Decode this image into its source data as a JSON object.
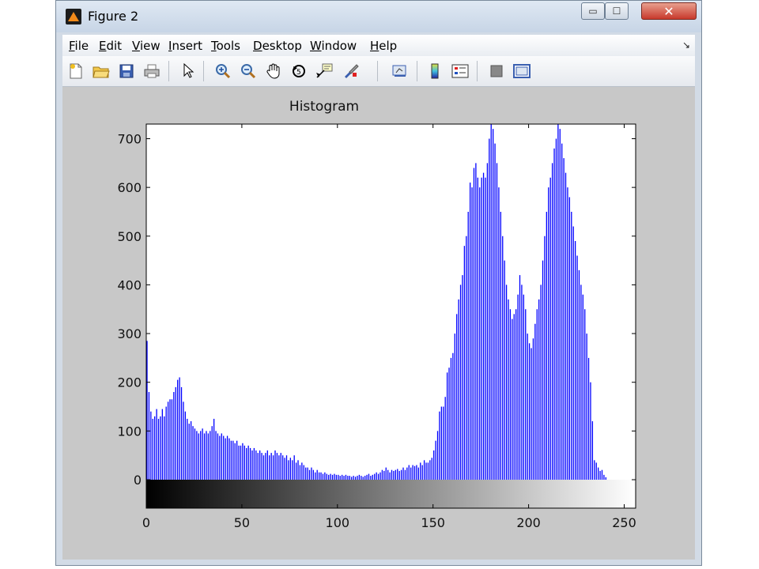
{
  "window": {
    "title": "Figure 2",
    "controls": {
      "minimize": "▭",
      "maximize": "☐",
      "close": "✕"
    }
  },
  "menu": {
    "items": [
      {
        "label": "File",
        "mnemonic": "F"
      },
      {
        "label": "Edit",
        "mnemonic": "E"
      },
      {
        "label": "View",
        "mnemonic": "V"
      },
      {
        "label": "Insert",
        "mnemonic": "I"
      },
      {
        "label": "Tools",
        "mnemonic": "T"
      },
      {
        "label": "Desktop",
        "mnemonic": "D"
      },
      {
        "label": "Window",
        "mnemonic": "W"
      },
      {
        "label": "Help",
        "mnemonic": "H"
      }
    ],
    "dock_icon": "↘"
  },
  "toolbar": {
    "tools": [
      "new-figure-icon",
      "open-file-icon",
      "save-icon",
      "print-icon",
      "select-arrow-icon",
      "zoom-in-icon",
      "zoom-out-icon",
      "pan-hand-icon",
      "rotate-3d-icon",
      "data-cursor-icon",
      "brush-icon",
      "link-plot-icon",
      "colorbar-icon",
      "legend-icon",
      "hide-plot-tools-icon",
      "show-plot-tools-icon"
    ]
  },
  "chart_data": {
    "type": "bar",
    "title": "Histogram",
    "xlabel": "",
    "ylabel": "",
    "xlim": [
      0,
      256
    ],
    "ylim": [
      0,
      730
    ],
    "x_ticks": [
      0,
      50,
      100,
      150,
      200,
      250
    ],
    "y_ticks": [
      0,
      100,
      200,
      300,
      400,
      500,
      600,
      700
    ],
    "bar_color": "#0000ff",
    "colorbar": "grayscale 0-255 below x-axis",
    "x_start": 0,
    "values": [
      285,
      180,
      140,
      125,
      130,
      145,
      125,
      130,
      145,
      130,
      150,
      160,
      165,
      165,
      180,
      190,
      205,
      210,
      190,
      160,
      140,
      125,
      115,
      120,
      110,
      105,
      100,
      95,
      100,
      105,
      95,
      100,
      95,
      100,
      110,
      125,
      100,
      95,
      90,
      95,
      90,
      85,
      90,
      85,
      80,
      80,
      75,
      80,
      70,
      70,
      75,
      70,
      65,
      70,
      65,
      60,
      65,
      60,
      55,
      60,
      55,
      50,
      55,
      60,
      50,
      55,
      50,
      60,
      55,
      50,
      55,
      50,
      45,
      50,
      40,
      45,
      40,
      50,
      35,
      40,
      30,
      35,
      30,
      25,
      25,
      20,
      25,
      20,
      15,
      20,
      15,
      15,
      12,
      15,
      12,
      10,
      12,
      10,
      12,
      10,
      10,
      8,
      10,
      8,
      10,
      8,
      8,
      6,
      8,
      6,
      8,
      10,
      8,
      6,
      8,
      10,
      12,
      8,
      10,
      12,
      15,
      12,
      15,
      20,
      18,
      25,
      20,
      15,
      20,
      18,
      20,
      22,
      18,
      20,
      25,
      20,
      25,
      30,
      25,
      30,
      28,
      30,
      25,
      35,
      30,
      40,
      35,
      35,
      40,
      45,
      60,
      80,
      100,
      140,
      150,
      150,
      170,
      220,
      230,
      250,
      260,
      300,
      340,
      370,
      400,
      420,
      480,
      500,
      550,
      610,
      600,
      640,
      650,
      620,
      600,
      620,
      630,
      620,
      650,
      700,
      730,
      720,
      690,
      650,
      600,
      550,
      500,
      450,
      400,
      370,
      350,
      330,
      340,
      350,
      380,
      420,
      400,
      380,
      350,
      300,
      280,
      270,
      290,
      320,
      350,
      370,
      400,
      450,
      500,
      550,
      600,
      620,
      650,
      680,
      700,
      730,
      720,
      690,
      660,
      630,
      600,
      580,
      550,
      520,
      490,
      460,
      430,
      400,
      380,
      350,
      300,
      250,
      200,
      120,
      40,
      35,
      25,
      18,
      20,
      10,
      5
    ]
  }
}
